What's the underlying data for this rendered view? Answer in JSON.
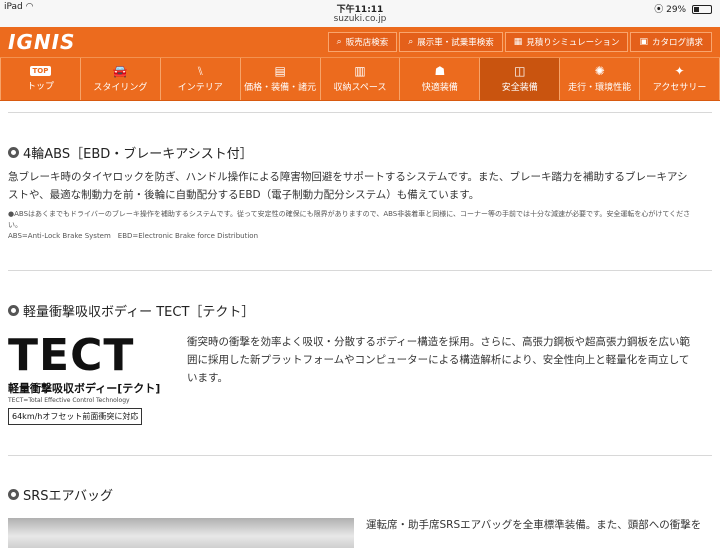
{
  "status_bar": {
    "device": "iPad",
    "wifi_icon": "wifi-icon",
    "time": "下午11:11",
    "url": "suzuki.co.jp",
    "battery_percent": "29%",
    "battery_level": 0.29
  },
  "header": {
    "logo": "IGNIS",
    "links": [
      {
        "icon": "search-icon",
        "glyph": "⌕",
        "label": "販売店検索"
      },
      {
        "icon": "search-icon",
        "glyph": "⌕",
        "label": "展示車・試乗車検索"
      },
      {
        "icon": "calculator-icon",
        "glyph": "▦",
        "label": "見積りシミュレーション"
      },
      {
        "icon": "catalog-icon",
        "glyph": "▣",
        "label": "カタログ請求"
      }
    ]
  },
  "nav": {
    "items": [
      {
        "icon": "top-icon",
        "badge": "TOP",
        "label": "トップ"
      },
      {
        "icon": "car-icon",
        "glyph": "🚘",
        "label": "スタイリング"
      },
      {
        "icon": "seat-icon",
        "glyph": "⑊",
        "label": "インテリア"
      },
      {
        "icon": "price-list-icon",
        "glyph": "▤",
        "label": "価格・装備・諸元"
      },
      {
        "icon": "storage-icon",
        "glyph": "▥",
        "label": "収納スペース"
      },
      {
        "icon": "comfort-icon",
        "glyph": "☗",
        "label": "快適装備"
      },
      {
        "icon": "safety-icon",
        "glyph": "◫",
        "label": "安全装備",
        "active": true
      },
      {
        "icon": "performance-icon",
        "glyph": "✺",
        "label": "走行・環境性能"
      },
      {
        "icon": "accessory-icon",
        "glyph": "✦",
        "label": "アクセサリー"
      }
    ]
  },
  "sections": {
    "abs": {
      "title": "4輪ABS［EBD・ブレーキアシスト付］",
      "body_line1": "急ブレーキ時のタイヤロックを防ぎ、ハンドル操作による障害物回避をサポートするシステムです。また、ブレーキ踏力を補助するブレーキアシ",
      "body_line2": "ストや、最適な制動力を前・後輪に自動配分するEBD（電子制動力配分システム）も備えています。",
      "note_line1": "●ABSはあくまでもドライバーのブレーキ操作を補助するシステムです。従って安定性の確保にも限界がありますので、ABS非装着車と同様に、コーナー等の手前では十分な減速が必要です。安全運転を心がけてくださ",
      "note_line2": "い。",
      "note_line3": "ABS=Anti-Lock Brake System　EBD=Electronic Brake force Distribution"
    },
    "tect": {
      "title": "軽量衝撃吸収ボディー TECT［テクト］",
      "logo_letters": "TECT",
      "logo_jp": "軽量衝撃吸収ボディー[テクト]",
      "logo_en": "TECT=Total Effective Control Technology",
      "logo_badge": "64km/hオフセット前面衝突に対応",
      "body_line1": "衝突時の衝撃を効率よく吸収・分散するボディー構造を採用。さらに、高張力鋼板や超高張力鋼板を広い範",
      "body_line2": "囲に採用した新プラットフォームやコンピューターによる構造解析により、安全性向上と軽量化を両立して",
      "body_line3": "います。"
    },
    "srs": {
      "title": "SRSエアバッグ",
      "body_line1": "運転席・助手席SRSエアバッグを全車標準装備。また、頭部への衝撃を"
    }
  }
}
